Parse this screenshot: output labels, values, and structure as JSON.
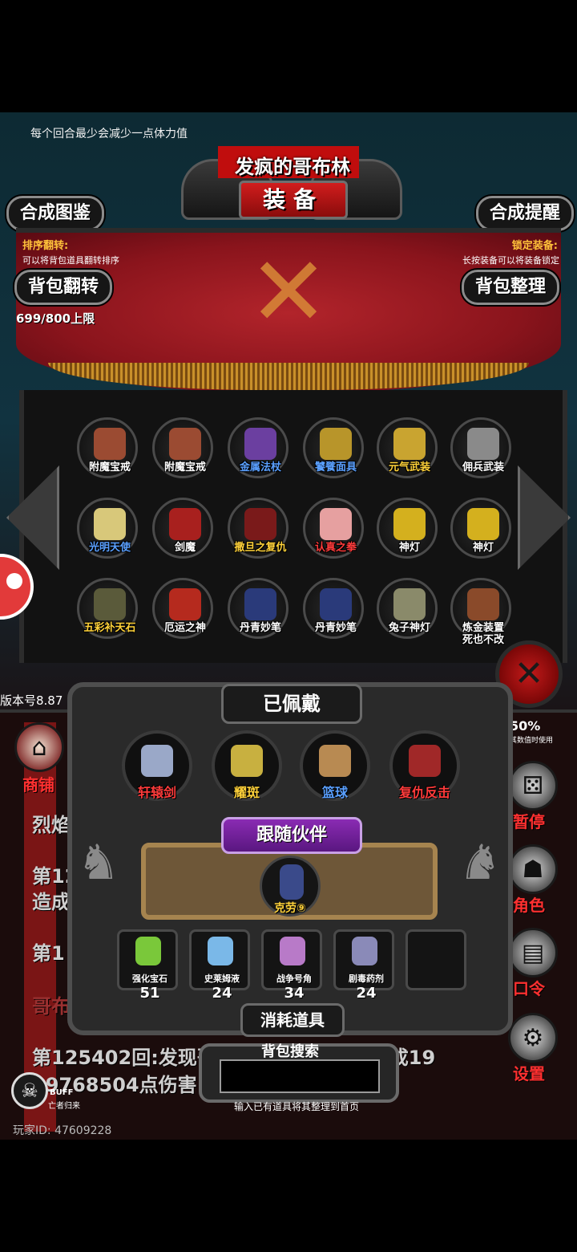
{
  "tip": "每个回合最少会减少一点体力值",
  "title": {
    "name": "发疯的哥布林",
    "tab": "装备"
  },
  "buttons": {
    "synth_guide": "合成图鉴",
    "synth_remind": "合成提醒",
    "bag_flip": "背包翻转",
    "bag_sort": "背包整理"
  },
  "hints": {
    "sort_flip_label": "排序翻转:",
    "sort_flip_desc": "可以将背包道具翻转排序",
    "lock_label": "锁定装备:",
    "lock_desc": "长按装备可以将装备锁定"
  },
  "capacity": "699/800上限",
  "inventory": [
    {
      "label": "附魔宝戒",
      "color": "#ffffff",
      "icon": "ring-icon",
      "fill": "#9b4b32"
    },
    {
      "label": "附魔宝戒",
      "color": "#ffffff",
      "icon": "ring-icon",
      "fill": "#9b4b32"
    },
    {
      "label": "金属法杖",
      "color": "#5aa0ff",
      "icon": "staff-icon",
      "fill": "#6b3fa0"
    },
    {
      "label": "饕餮面具",
      "color": "#5aa0ff",
      "icon": "mask-icon",
      "fill": "#b8952a"
    },
    {
      "label": "元气武装",
      "color": "#ffd23a",
      "icon": "armor-icon",
      "fill": "#c9a430"
    },
    {
      "label": "佣兵武装",
      "color": "#ffffff",
      "icon": "helmet-icon",
      "fill": "#8a8a8a"
    },
    {
      "label": "光明天使",
      "color": "#5aa0ff",
      "icon": "angel-icon",
      "fill": "#d8c87a"
    },
    {
      "label": "剑魔",
      "color": "#ffffff",
      "icon": "demon-icon",
      "fill": "#a8201e"
    },
    {
      "label": "撒旦之复仇",
      "color": "#ffd23a",
      "icon": "satan-icon",
      "fill": "#7a1a1a"
    },
    {
      "label": "认真之拳",
      "color": "#ff3b3b",
      "icon": "fist-icon",
      "fill": "#e6a0a0"
    },
    {
      "label": "神灯",
      "color": "#ffffff",
      "icon": "lamp-icon",
      "fill": "#d4b01e"
    },
    {
      "label": "神灯",
      "color": "#ffffff",
      "icon": "lamp-icon",
      "fill": "#d4b01e"
    },
    {
      "label": "五彩补天石",
      "color": "#ffd23a",
      "icon": "stone-icon",
      "fill": "#5a5a3a"
    },
    {
      "label": "厄运之神",
      "color": "#ffffff",
      "icon": "doom-icon",
      "fill": "#b52a1e"
    },
    {
      "label": "丹青妙笔",
      "color": "#ffffff",
      "icon": "brush-icon",
      "fill": "#2a3a7a"
    },
    {
      "label": "丹青妙笔",
      "color": "#ffffff",
      "icon": "brush-icon",
      "fill": "#2a3a7a"
    },
    {
      "label": "兔子神灯",
      "color": "#ffffff",
      "icon": "rabbit-lamp-icon",
      "fill": "#8a8a6a"
    },
    {
      "label": "炼金装置\n死也不改",
      "color": "#ffffff",
      "icon": "alchemy-icon",
      "fill": "#8a4a2a"
    }
  ],
  "worn": {
    "title": "已佩戴",
    "items": [
      {
        "label": "轩辕剑",
        "color": "#ff3b3b",
        "icon": "sword-icon",
        "fill": "#9aa8c8"
      },
      {
        "label": "耀斑",
        "color": "#ffd23a",
        "icon": "flare-icon",
        "fill": "#c8b040"
      },
      {
        "label": "篮球",
        "color": "#5aa0ff",
        "icon": "basketball-icon",
        "fill": "#b88a52"
      },
      {
        "label": "复仇反击",
        "color": "#ff3b3b",
        "icon": "revenge-icon",
        "fill": "#a02828"
      }
    ]
  },
  "companion": {
    "title": "跟随伙伴",
    "name": "克劳⑨"
  },
  "consumables": {
    "title": "消耗道具",
    "items": [
      {
        "label": "强化宝石",
        "count": "51",
        "icon": "gem-icon",
        "fill": "#7ac83a"
      },
      {
        "label": "史莱姆液",
        "count": "24",
        "icon": "potion-icon",
        "fill": "#7ab8e8"
      },
      {
        "label": "战争号角",
        "count": "34",
        "icon": "horn-icon",
        "fill": "#b87ac8"
      },
      {
        "label": "剧毒药剂",
        "count": "24",
        "icon": "poison-icon",
        "fill": "#8a8ab8"
      }
    ]
  },
  "search": {
    "title": "背包搜索",
    "value": "",
    "hint": "输入已有道具将其整理到首页"
  },
  "version": "版本号8.87",
  "side": {
    "shop": "商铺",
    "pause": "暂停",
    "role": "角色",
    "code": "口令",
    "settings": "设置",
    "percent": "50%",
    "percent_note": "其数值时使用"
  },
  "log": {
    "line1": "烈焰",
    "line2a": "第125",
    "line2b": "造成",
    "line3": "第1",
    "line4": "哥布",
    "line5": "第125402回:发现哥布林并使用圣光弹造成19",
    "line6": "99768504点伤害"
  },
  "buff": {
    "title": "BUFF",
    "name": "亡者归来"
  },
  "player_id": "玩家ID: 47609228"
}
